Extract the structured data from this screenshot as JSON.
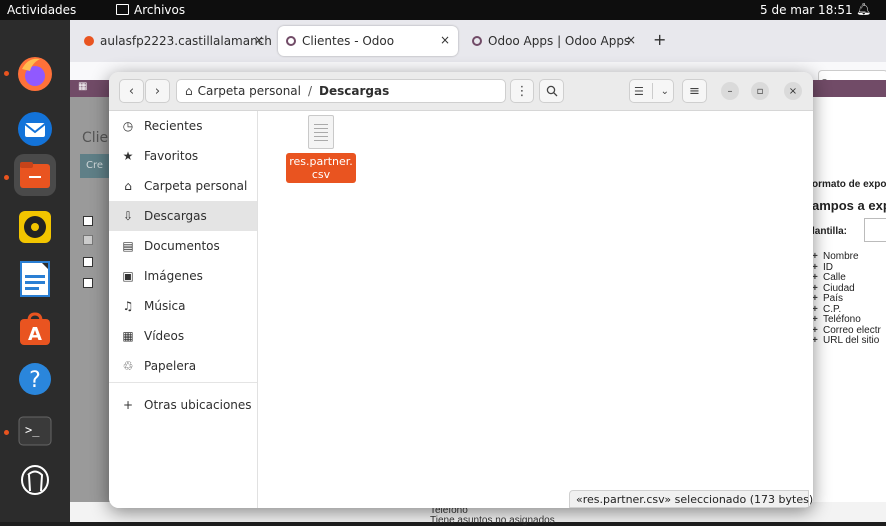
{
  "topbar": {
    "activities": "Actividades",
    "app_name": "Archivos",
    "clock": "5 de mar  18:51"
  },
  "browser": {
    "tabs": [
      {
        "label": "aulasfp2223.castillalamanch",
        "close": "×"
      },
      {
        "label": "Clientes - Odoo",
        "close": "×"
      },
      {
        "label": "Odoo Apps | Odoo Apps",
        "close": "×"
      }
    ],
    "new_tab": "+",
    "url_fragment": "8"
  },
  "odoo": {
    "clientes_fragment": "Clie",
    "crear_fragment": "Cre",
    "export": {
      "format_label": "ormato de expo",
      "campos_title": "ampos a exp",
      "plantilla_label": "lantilla:",
      "fields": [
        "Nombre",
        "ID",
        "Calle",
        "Ciudad",
        "País",
        "C.P.",
        "Teléfono",
        "Correo electr",
        "URL del sitio"
      ]
    },
    "behind_row_1": "Teléfono",
    "behind_row_2": "Tiene asuntos no asignados"
  },
  "dialog": {
    "path": {
      "home": "Carpeta personal",
      "separator": "/",
      "current": "Descargas"
    },
    "sidebar": [
      {
        "label": "Recientes",
        "icon": "clock-icon",
        "glyph": "◷"
      },
      {
        "label": "Favoritos",
        "icon": "star-icon",
        "glyph": "★"
      },
      {
        "label": "Carpeta personal",
        "icon": "home-icon",
        "glyph": "⌂"
      },
      {
        "label": "Descargas",
        "icon": "download-icon",
        "glyph": "⇩"
      },
      {
        "label": "Documentos",
        "icon": "document-icon",
        "glyph": "▤"
      },
      {
        "label": "Imágenes",
        "icon": "image-icon",
        "glyph": "▣"
      },
      {
        "label": "Música",
        "icon": "music-icon",
        "glyph": "♫"
      },
      {
        "label": "Vídeos",
        "icon": "video-icon",
        "glyph": "▦"
      },
      {
        "label": "Papelera",
        "icon": "trash-icon",
        "glyph": "♲"
      },
      {
        "label": "Otras ubicaciones",
        "icon": "plus-icon",
        "glyph": "+"
      }
    ],
    "file": {
      "name_line1": "res.partner.",
      "name_line2": "csv"
    },
    "status": "«res.partner.csv» seleccionado  (173 bytes)"
  },
  "colors": {
    "accent": "#e95420",
    "odoo": "#714b67",
    "dock": "#2c2c2c"
  }
}
